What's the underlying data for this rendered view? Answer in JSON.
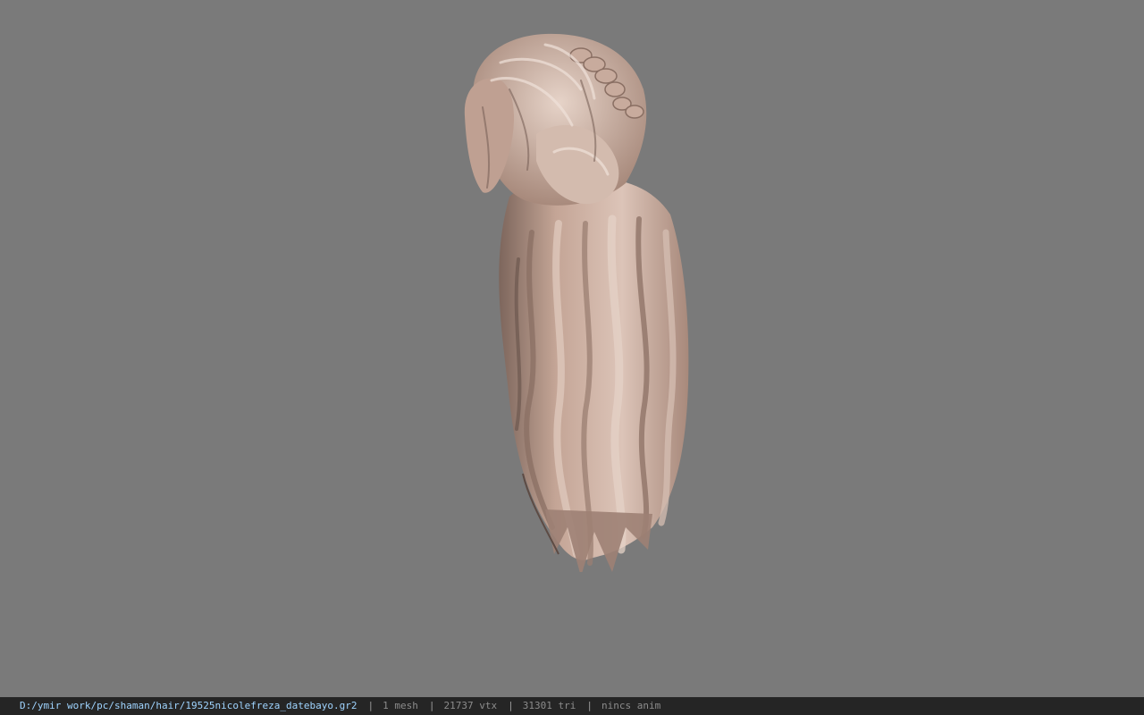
{
  "viewport": {
    "background_color": "#7a7a7a",
    "model": {
      "description_icon": "hair-mesh",
      "base_color": "#c9a99b",
      "shadow_color": "#6e5850",
      "highlight_color": "#e3cfc4"
    }
  },
  "statusbar": {
    "background_color": "#252525",
    "path_color": "#9fd4ff",
    "file_path": "D:/ymir work/pc/shaman/hair/19525nicolefreza_datebayo.gr2",
    "separator": "|",
    "mesh_count": "1 mesh",
    "vertex_count": "21737 vtx",
    "triangle_count": "31301 tri",
    "anim_status": "nincs anim"
  }
}
